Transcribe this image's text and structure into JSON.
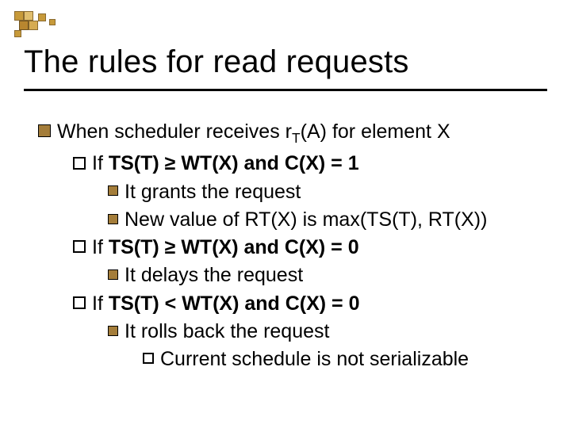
{
  "slide": {
    "title": "The rules for read requests",
    "lvl1_intro_pre": "When scheduler receives r",
    "lvl1_intro_sub": "T",
    "lvl1_intro_post": "(A) for element X",
    "case1_label": "If ",
    "case1_cond": "TS(T)  ≥ WT(X) and C(X) = 1",
    "case1_act1": "It grants the request",
    "case1_act2": "New value of RT(X) is max(TS(T), RT(X))",
    "case2_label": "If ",
    "case2_cond": "TS(T)  ≥ WT(X) and C(X) = 0",
    "case2_act1": "It delays the request",
    "case3_label": "If ",
    "case3_cond": "TS(T)  < WT(X) and C(X) = 0",
    "case3_act1": "It rolls back the request",
    "case3_act1_sub": "Current schedule is not serializable"
  },
  "colors": {
    "accent_fill": "#c8a24a",
    "accent_border": "#8a6a2f"
  }
}
